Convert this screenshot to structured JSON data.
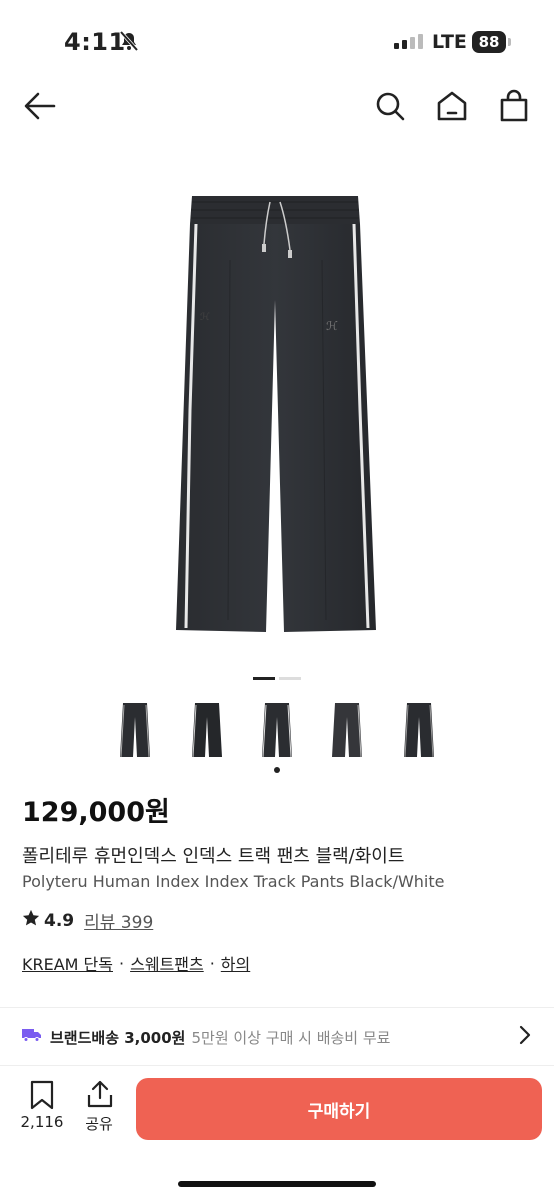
{
  "status_bar": {
    "time": "4:11",
    "network": "LTE",
    "battery": "88"
  },
  "product": {
    "price": "129,000원",
    "name_ko": "폴리테루 휴먼인덱스 인덱스 트랙 팬츠 블랙/화이트",
    "name_en": "Polyteru Human Index Index Track Pants Black/White",
    "rating": "4.9",
    "review_link": "리뷰 399",
    "tags": [
      "KREAM 단독",
      "스웨트팬츠",
      "하의"
    ],
    "tag_separator": "·"
  },
  "shipping": {
    "label": "브랜드배송 3,000원",
    "note": "5만원 이상 구매 시 배송비 무료"
  },
  "bottom_bar": {
    "save_count": "2,116",
    "share_label": "공유",
    "buy_label": "구매하기"
  },
  "colors": {
    "accent": "#ef6253",
    "shipping_icon": "#7a5cf0"
  },
  "icons": [
    "back-arrow-icon",
    "search-icon",
    "home-icon",
    "shopping-bag-icon",
    "star-icon",
    "truck-icon",
    "chevron-right-icon",
    "bookmark-icon",
    "share-icon",
    "bell-slash-icon"
  ]
}
